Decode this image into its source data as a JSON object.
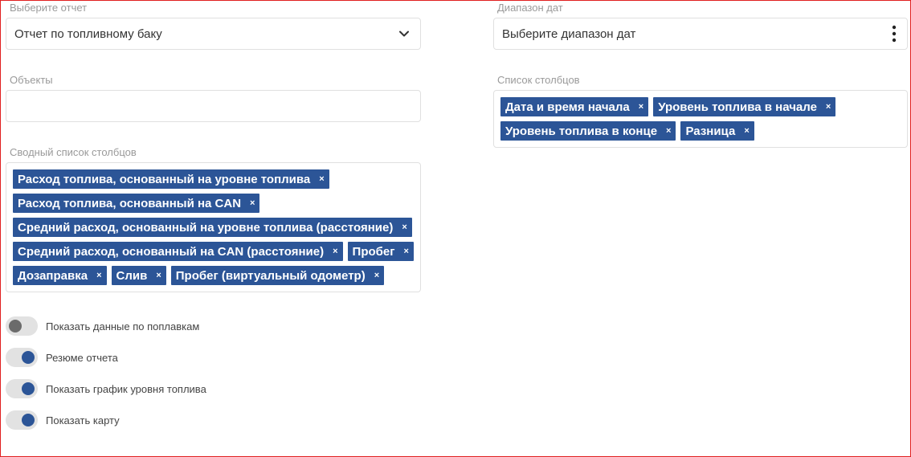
{
  "report_select": {
    "label": "Выберите отчет",
    "value": "Отчет по топливному баку",
    "icon": "chevron-down-icon"
  },
  "date_range": {
    "label": "Диапазон дат",
    "placeholder": "Выберите диапазон дат",
    "icon": "more-vertical-icon"
  },
  "objects": {
    "label": "Объекты",
    "value": ""
  },
  "columns": {
    "label": "Список столбцов",
    "chips": [
      "Дата и время начала",
      "Уровень топлива в начале",
      "Уровень топлива в конце",
      "Разница"
    ]
  },
  "summary_columns": {
    "label": "Сводный список столбцов",
    "chips": [
      "Расход топлива, основанный на уровне топлива",
      "Расход топлива, основанный на CAN",
      "Средний расход, основанный на уровне топлива (расстояние)",
      "Средний расход, основанный на CAN (расстояние)",
      "Пробег",
      "Дозаправка",
      "Слив",
      "Пробег (виртуальный одометр)"
    ]
  },
  "chip_remove_glyph": "×",
  "toggles": [
    {
      "label": "Показать данные по поплавкам",
      "on": false
    },
    {
      "label": "Резюме отчета",
      "on": true
    },
    {
      "label": "Показать график уровня топлива",
      "on": true
    },
    {
      "label": "Показать карту",
      "on": true
    }
  ],
  "colors": {
    "accent": "#2c5597",
    "frame": "#e02020"
  }
}
